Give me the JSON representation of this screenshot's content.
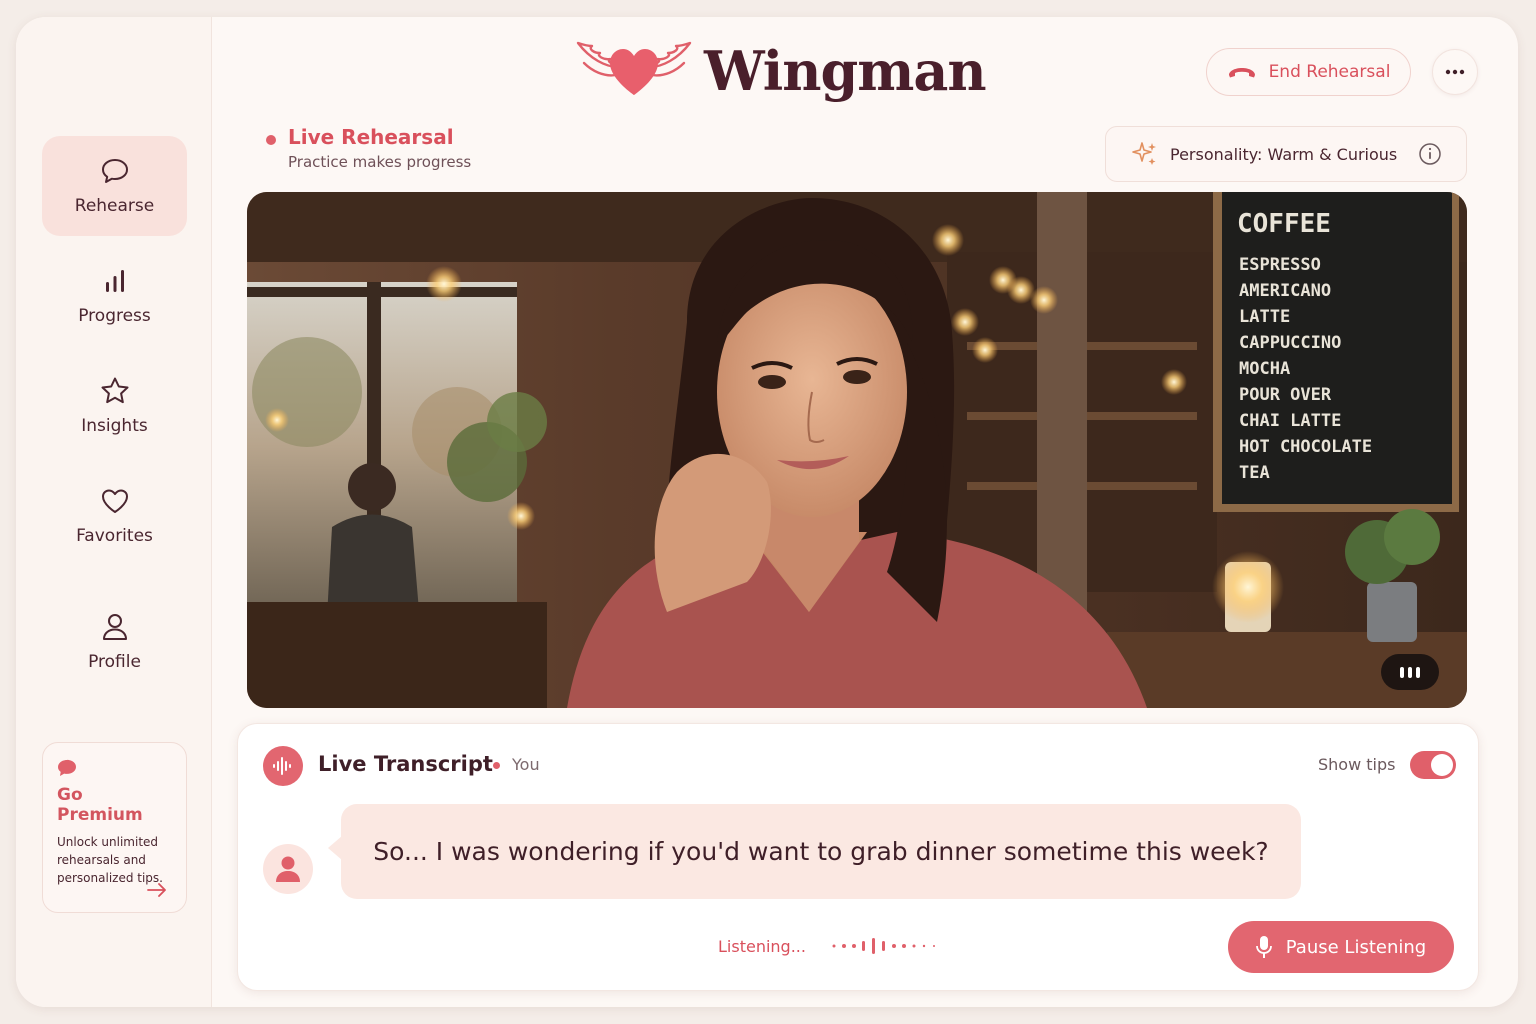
{
  "app": {
    "name": "Wingman"
  },
  "sidebar": {
    "items": [
      {
        "label": "Rehearse",
        "icon": "chat-bubble-icon",
        "active": true
      },
      {
        "label": "Progress",
        "icon": "bar-chart-icon",
        "active": false
      },
      {
        "label": "Insights",
        "icon": "star-icon",
        "active": false
      },
      {
        "label": "Favorites",
        "icon": "heart-icon",
        "active": false
      },
      {
        "label": "Profile",
        "icon": "user-icon",
        "active": false
      }
    ],
    "premium": {
      "title": "Go Premium",
      "description": "Unlock unlimited rehearsals and personalized tips."
    }
  },
  "header": {
    "end_label": "End Rehearsal",
    "live_title": "Live Rehearsal",
    "live_subtitle": "Practice makes progress",
    "personality": "Personality: Warm & Curious"
  },
  "video": {
    "menu_board": [
      "COFFEE",
      "ESPRESSO",
      "AMERICANO",
      "LATTE",
      "CAPPUCCINO",
      "MOCHA",
      "POUR OVER",
      "CHAI LATTE",
      "HOT CHOCOLATE",
      "TEA"
    ]
  },
  "transcript": {
    "title": "Live Transcript",
    "speaker": "You",
    "tips_label": "Show tips",
    "tips_on": true,
    "message": "So... I was wondering if you'd want to grab dinner sometime this week?",
    "status": "Listening...",
    "pause_label": "Pause Listening"
  },
  "colors": {
    "accent": "#e0606a",
    "accent_soft": "#fbe8e2",
    "text_dark": "#4a1f2b",
    "background": "#fdf8f5"
  }
}
